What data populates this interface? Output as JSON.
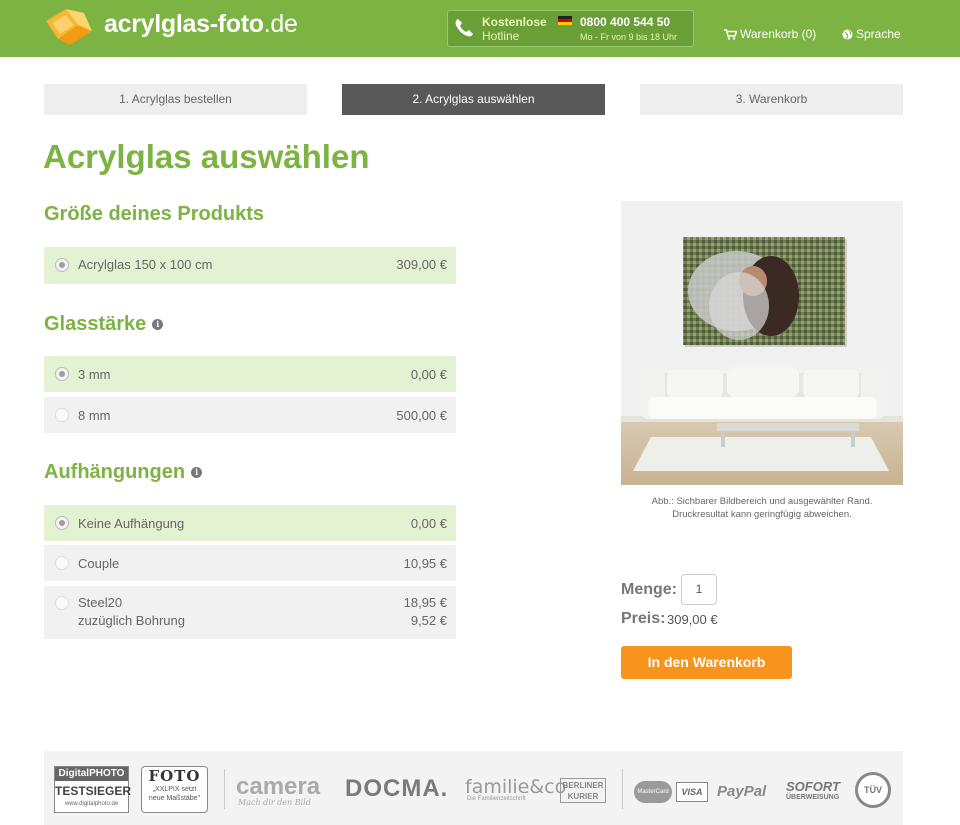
{
  "header": {
    "brand_main": "acrylglas-foto",
    "brand_tld": ".de",
    "hotline": {
      "label_top": "Kostenlose",
      "label_bottom": "Hotline",
      "number": "0800 400 544 50",
      "hours": "Mo - Fr von 9 bis 18 Uhr"
    },
    "cart_label": "Warenkorb (0)",
    "language_label": "Sprache"
  },
  "steps": [
    {
      "label": "1. Acrylglas bestellen",
      "active": false
    },
    {
      "label": "2. Acrylglas auswählen",
      "active": true
    },
    {
      "label": "3. Warenkorb",
      "active": false
    }
  ],
  "page_title": "Acrylglas auswählen",
  "size_section": {
    "title": "Größe deines Produkts",
    "options": [
      {
        "label": "Acrylglas 150 x 100 cm",
        "price": "309,00 €",
        "selected": true
      }
    ]
  },
  "thickness_section": {
    "title": "Glasstärke",
    "info_icon": "i",
    "options": [
      {
        "label": "3 mm",
        "price": "0,00 €",
        "selected": true
      },
      {
        "label": "8 mm",
        "price": "500,00 €",
        "selected": false
      }
    ]
  },
  "hanging_section": {
    "title": "Aufhängungen",
    "info_icon": "i",
    "options": [
      {
        "label": "Keine Aufhängung",
        "price": "0,00 €",
        "selected": true
      },
      {
        "label": "Couple",
        "price": "10,95 €",
        "selected": false
      },
      {
        "label": "Steel20",
        "price": "18,95 €",
        "selected": false,
        "extra_label": "zuzüglich Bohrung",
        "extra_price": "9,52 €"
      }
    ]
  },
  "preview": {
    "caption_line1": "Abb.: Sichbarer Bildbereich und ausgewählter Rand.",
    "caption_line2": "Druckresultat kann geringfügig abweichen."
  },
  "order": {
    "quantity_label": "Menge:",
    "quantity_value": "1",
    "price_label": "Preis:",
    "price_value": "309,00 €",
    "button_label": "In den Warenkorb"
  },
  "footer": {
    "badges": [
      {
        "top": "DigitalPHOTO",
        "main": "TESTSIEGER",
        "sub": "www.digitalphoto.de"
      },
      {
        "top": "FOTO",
        "main": "„XXLPIX setzt",
        "sub": "neue Maßstäbe\""
      }
    ],
    "press": [
      {
        "name": "camera",
        "sub": "Mach dir den Bild"
      },
      {
        "name": "DOCMA.",
        "sub": ""
      },
      {
        "name": "familie&co",
        "sub": "Die Familienzeitschrift"
      },
      {
        "name": "BERLINER",
        "sub": "KURIER"
      }
    ],
    "payments": [
      "MasterCard",
      "VISA",
      "PayPal",
      "SOFORT",
      "ÜBERWEISUNG",
      "TÜV"
    ]
  },
  "colors": {
    "brand_green": "#7cb342",
    "selected_row": "#e2f2d2",
    "cta_orange": "#f7941d",
    "active_step": "#595959"
  }
}
